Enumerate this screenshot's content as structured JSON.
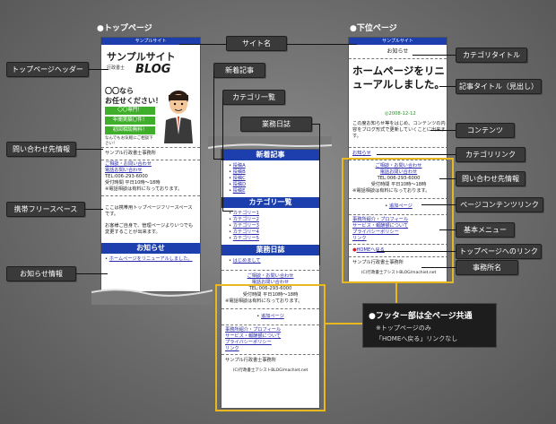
{
  "sections": {
    "top_page": "●トップページ",
    "sub_page": "●下位ページ"
  },
  "site_name": "サンプルサイト",
  "top_phone": {
    "logo_line1": "サンプルサイト",
    "logo_sub": "行政書士",
    "logo_line2": "BLOG",
    "banner_line1": "〇〇なら",
    "banner_line2": "お任せください！",
    "btn1": "〇〇専門！",
    "btn2": "年間実績〇件！",
    "btn3": "初回相談無料！",
    "banner_note": "なんでもお気軽にご相談下さい！",
    "office_line": "サンプル行政書士事務所",
    "free_text_1": "ここは携帯用トップページフリースペースです。",
    "free_text_2": "お客様ご自身で、管理ページよりいつでも変更することが出来ます。",
    "notice_heading": "お知らせ",
    "notice_item": "ホームページをリニューアルしました。"
  },
  "mid_phone": {
    "new_heading": "新着記事",
    "new_items": [
      "投稿A",
      "投稿B",
      "投稿C",
      "投稿D",
      "投稿E"
    ],
    "cat_heading": "カテゴリ一覧",
    "cat_items": [
      "カテゴリー1",
      "カテゴリー2",
      "カテゴリー3",
      "カテゴリー4",
      "カテゴリー5"
    ],
    "diary_heading": "業務日誌",
    "diary_item": "はじめまして"
  },
  "footer": {
    "contact_link": "ご相談・お問い合わせ",
    "phone_link": "電話お問い合わせ",
    "tel": "TEL:006-293-6000",
    "hours": "受付時間 平日10時〜18時",
    "note": "※電話相談は有料になっております。",
    "page_content": "追加ページ",
    "menu_1": "事務所紹介・プロフィール",
    "menu_2": "サービス・報酬額について",
    "menu_3": "プライバシーポリシー",
    "menu_4": "リンク",
    "home_link": "HOMEへ戻る",
    "office": "サンプル行政書士事務所",
    "copyright": "(C)行政書士アシストBLOG/machiet.net"
  },
  "sub_phone": {
    "category_title": "お知らせ",
    "article_title": "ホームページをリニューアルしました。",
    "date": "2008-12-12",
    "content": "この度お知らせ等をはじめ、コンテンツの内容をブログ形式で更新していくことに出来ます。",
    "category_link": "お知らせ"
  },
  "labels": {
    "site_name": "サイト名",
    "top_header": "トップページヘッダー",
    "new_articles": "新着記事",
    "category_list": "カテゴリ一覧",
    "work_diary": "業務日誌",
    "contact_info": "問い合わせ先情報",
    "free_space": "携帯フリースペース",
    "notice_info": "お知らせ情報",
    "category_title": "カテゴリタイトル",
    "article_title": "記事タイトル（見出し）",
    "contents": "コンテンツ",
    "category_link": "カテゴリリンク",
    "contact_info_r": "問い合わせ先情報",
    "page_content_link": "ページコンテンツリンク",
    "basic_menu": "基本メニュー",
    "top_link": "トップページへのリンク",
    "office_name": "事務所名"
  },
  "callout": {
    "title": "●フッター部は全ページ共通",
    "note_1": "※トップページのみ",
    "note_2": "「HOMEへ戻る」リンクなし"
  },
  "colors": {
    "header_blue": "#1d3fae",
    "highlight": "#e7b820",
    "label_bg": "#3a3a3a"
  }
}
